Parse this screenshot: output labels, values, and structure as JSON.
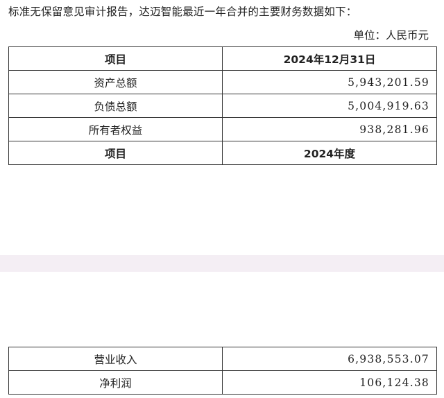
{
  "document": {
    "intro_text": "标准无保留意见审计报告，达迈智能最近一年合并的主要财务数据如下：",
    "unit_text": "单位：人民币元"
  },
  "balance_table": {
    "header": {
      "item": "项目",
      "period": "2024年12月31日"
    },
    "rows": [
      {
        "label": "资产总额",
        "value": "5,943,201.59"
      },
      {
        "label": "负债总额",
        "value": "5,004,919.63"
      },
      {
        "label": "所有者权益",
        "value": "938,281.96"
      }
    ],
    "second_header": {
      "item": "项目",
      "period": "2024年度"
    }
  },
  "income_table": {
    "rows": [
      {
        "label": "营业收入",
        "value": "6,938,553.07"
      },
      {
        "label": "净利润",
        "value": "106,124.38"
      }
    ]
  },
  "colors": {
    "separator_band": "#f4eef4",
    "border": "#333333",
    "text": "#222222"
  }
}
